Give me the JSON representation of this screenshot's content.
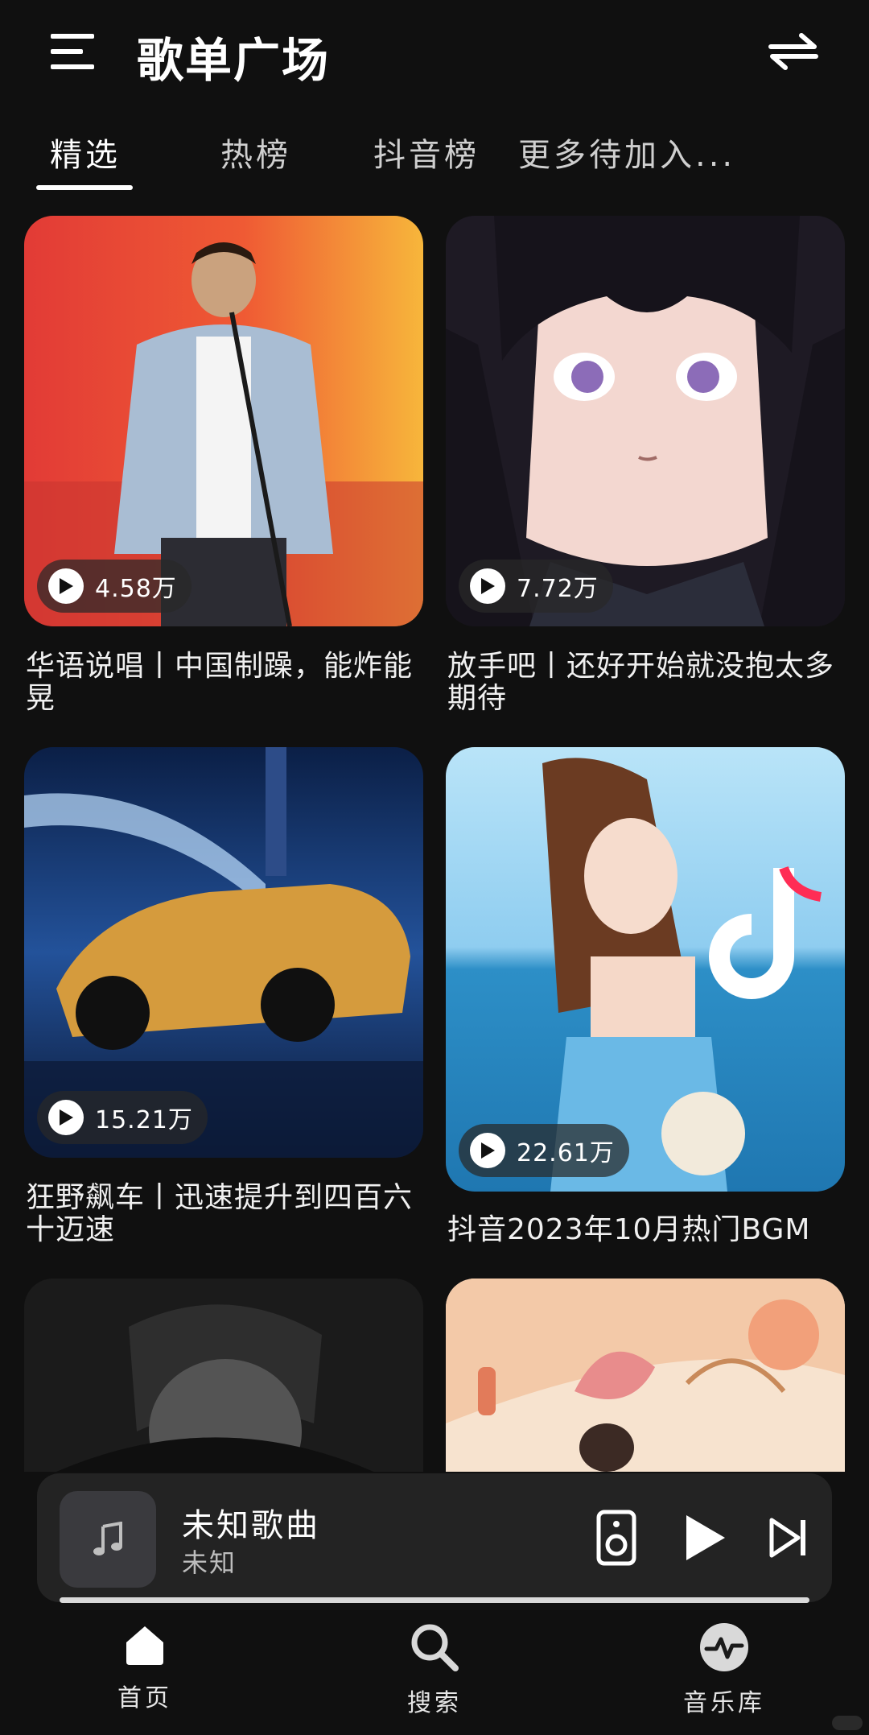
{
  "header": {
    "title": "歌单广场",
    "menu_icon": "menu-icon",
    "swap_icon": "swap-arrows-icon"
  },
  "tabs": [
    {
      "label": "精选",
      "active": true
    },
    {
      "label": "热榜",
      "active": false
    },
    {
      "label": "抖音榜",
      "active": false
    },
    {
      "label": "更多待加入...",
      "active": false
    }
  ],
  "playlists": [
    {
      "title": "华语说唱丨中国制躁，能炸能晃",
      "plays": "4.58万",
      "cover_colors": [
        "#e8433b",
        "#f6b43a"
      ]
    },
    {
      "title": "放手吧丨还好开始就没抱太多期待",
      "plays": "7.72万",
      "cover_colors": [
        "#f4d9d4",
        "#1e1a24"
      ]
    },
    {
      "title": "狂野飙车丨迅速提升到四百六十迈速",
      "plays": "15.21万",
      "cover_colors": [
        "#0c2a5a",
        "#6ea8e6"
      ]
    },
    {
      "title": "抖音2023年10月热门BGM",
      "plays": "22.61万",
      "cover_colors": [
        "#9fd3ee",
        "#3aa3d9"
      ]
    },
    {
      "title": "",
      "plays": "",
      "cover_colors": [
        "#1b1b1b",
        "#3d3d3d"
      ]
    },
    {
      "title": "",
      "plays": "",
      "cover_colors": [
        "#f3c9a8",
        "#f7e3cf"
      ]
    }
  ],
  "player": {
    "song_title": "未知歌曲",
    "artist": "未知",
    "icons": [
      "music-note-icon",
      "speaker-icon",
      "play-icon",
      "skip-next-icon"
    ],
    "progress": 1.0
  },
  "bottom_nav": [
    {
      "label": "首页",
      "icon": "home-icon"
    },
    {
      "label": "搜索",
      "icon": "search-icon"
    },
    {
      "label": "音乐库",
      "icon": "music-library-icon"
    }
  ],
  "colors": {
    "background": "#101010",
    "player_bg": "#232323",
    "text_primary": "#ffffff"
  }
}
